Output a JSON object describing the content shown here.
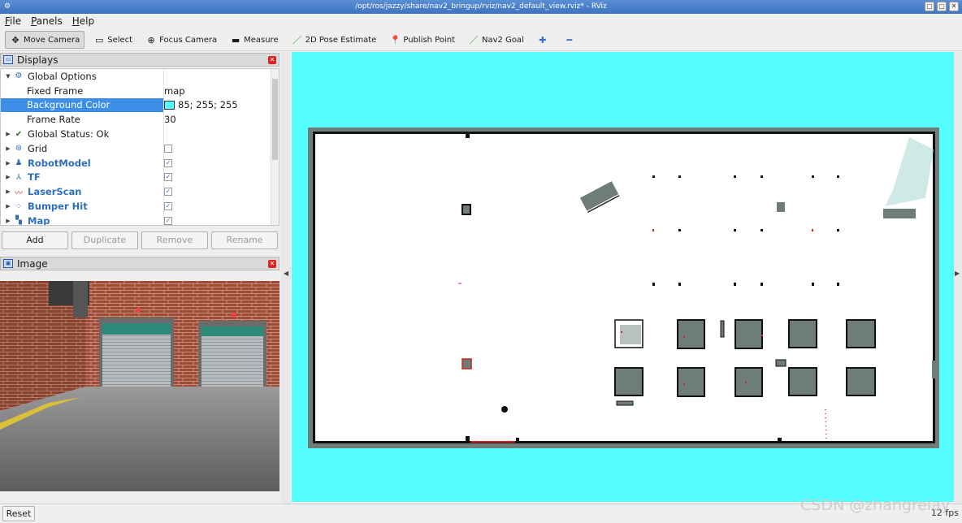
{
  "window": {
    "title": "/opt/ros/jazzy/share/nav2_bringup/rviz/nav2_default_view.rviz* - RViz",
    "controls": [
      "▢",
      "▢",
      "✕"
    ]
  },
  "menu": [
    "File",
    "Panels",
    "Help"
  ],
  "toolbar": [
    {
      "label": "Move Camera",
      "icon": "move-camera-icon",
      "glyph": "✥",
      "active": true
    },
    {
      "label": "Select",
      "icon": "select-icon",
      "glyph": "▭",
      "active": false
    },
    {
      "label": "Focus Camera",
      "icon": "focus-camera-icon",
      "glyph": "⊕",
      "active": false
    },
    {
      "label": "Measure",
      "icon": "measure-icon",
      "glyph": "▬",
      "active": false
    },
    {
      "label": "2D Pose Estimate",
      "icon": "pose-estimate-icon",
      "glyph": "／",
      "active": false
    },
    {
      "label": "Publish Point",
      "icon": "publish-point-icon",
      "glyph": "📍",
      "active": false
    },
    {
      "label": "Nav2 Goal",
      "icon": "nav2-goal-icon",
      "glyph": "／",
      "active": false
    },
    {
      "label": "",
      "icon": "add-tool-icon",
      "glyph": "✚",
      "active": false
    },
    {
      "label": "",
      "icon": "remove-tool-icon",
      "glyph": "━",
      "active": false
    }
  ],
  "displays_panel": {
    "title": "Displays",
    "rows": [
      {
        "name": "Global Options",
        "icon": "gear-icon",
        "glyph": "⚙",
        "arrow": "▼",
        "value": "",
        "indent": false,
        "blue": false
      },
      {
        "name": "Fixed Frame",
        "value": "map",
        "indent": true,
        "blue": false
      },
      {
        "name": "Background Color",
        "value": "85; 255; 255",
        "indent": true,
        "swatch": "#55ffff",
        "selected": true,
        "blue": false
      },
      {
        "name": "Frame Rate",
        "value": "30",
        "indent": true,
        "blue": false
      },
      {
        "name": "Global Status: Ok",
        "icon": "check-icon",
        "glyph": "✔",
        "arrow": "▶",
        "value": "",
        "indent": false,
        "blue": false
      },
      {
        "name": "Grid",
        "icon": "grid-icon",
        "glyph": "⊛",
        "arrow": "▶",
        "checkbox": false,
        "indent": false,
        "blue": false
      },
      {
        "name": "RobotModel",
        "icon": "robot-model-icon",
        "glyph": "♟",
        "arrow": "▶",
        "checkbox": true,
        "indent": false,
        "blue": true
      },
      {
        "name": "TF",
        "icon": "tf-icon",
        "glyph": "⅄",
        "arrow": "▶",
        "checkbox": true,
        "indent": false,
        "blue": true
      },
      {
        "name": "LaserScan",
        "icon": "laserscan-icon",
        "glyph": "〰",
        "arrow": "▶",
        "checkbox": true,
        "indent": false,
        "blue": true
      },
      {
        "name": "Bumper Hit",
        "icon": "bumper-hit-icon",
        "glyph": "⁘",
        "arrow": "▶",
        "checkbox": true,
        "indent": false,
        "blue": true
      },
      {
        "name": "Map",
        "icon": "map-icon",
        "glyph": "▚",
        "arrow": "▶",
        "checkbox": true,
        "indent": false,
        "blue": true
      }
    ],
    "buttons": [
      {
        "label": "Add",
        "enabled": true
      },
      {
        "label": "Duplicate",
        "enabled": false
      },
      {
        "label": "Remove",
        "enabled": false
      },
      {
        "label": "Rename",
        "enabled": false
      }
    ]
  },
  "image_panel": {
    "title": "Image"
  },
  "status_bar": {
    "reset_label": "Reset",
    "fps": "12 fps",
    "watermark": "CSDN @zhangrelay"
  },
  "colors": {
    "background": "#55ffff",
    "selection": "#3d8ee6",
    "accent": "#2d6fbf"
  }
}
